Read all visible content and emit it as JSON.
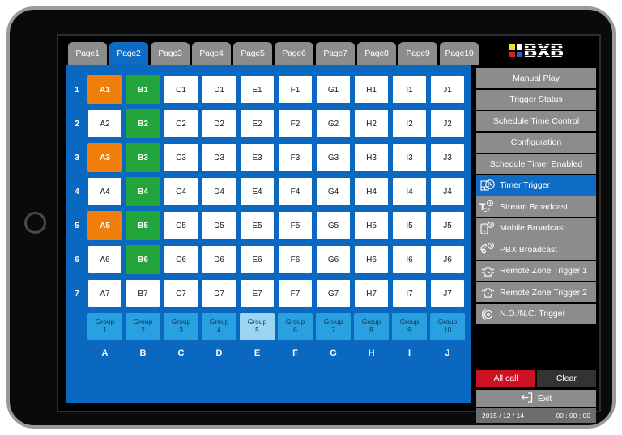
{
  "tabs": [
    {
      "label": "Page1",
      "active": false
    },
    {
      "label": "Page2",
      "active": true
    },
    {
      "label": "Page3",
      "active": false
    },
    {
      "label": "Page4",
      "active": false
    },
    {
      "label": "Page5",
      "active": false
    },
    {
      "label": "Page6",
      "active": false
    },
    {
      "label": "Page7",
      "active": false
    },
    {
      "label": "Page8",
      "active": false
    },
    {
      "label": "Page9",
      "active": false
    },
    {
      "label": "Page10",
      "active": false
    }
  ],
  "grid": {
    "row_numbers": [
      "1",
      "2",
      "3",
      "4",
      "5",
      "6",
      "7"
    ],
    "column_letters": [
      "A",
      "B",
      "C",
      "D",
      "E",
      "F",
      "G",
      "H",
      "I",
      "J"
    ],
    "rows": [
      [
        {
          "label": "A1",
          "state": "orange"
        },
        {
          "label": "B1",
          "state": "green"
        },
        {
          "label": "C1",
          "state": "off"
        },
        {
          "label": "D1",
          "state": "off"
        },
        {
          "label": "E1",
          "state": "off"
        },
        {
          "label": "F1",
          "state": "off"
        },
        {
          "label": "G1",
          "state": "off"
        },
        {
          "label": "H1",
          "state": "off"
        },
        {
          "label": "I1",
          "state": "off"
        },
        {
          "label": "J1",
          "state": "off"
        }
      ],
      [
        {
          "label": "A2",
          "state": "off"
        },
        {
          "label": "B2",
          "state": "green"
        },
        {
          "label": "C2",
          "state": "off"
        },
        {
          "label": "D2",
          "state": "off"
        },
        {
          "label": "E2",
          "state": "off"
        },
        {
          "label": "F2",
          "state": "off"
        },
        {
          "label": "G2",
          "state": "off"
        },
        {
          "label": "H2",
          "state": "off"
        },
        {
          "label": "I2",
          "state": "off"
        },
        {
          "label": "J2",
          "state": "off"
        }
      ],
      [
        {
          "label": "A3",
          "state": "orange"
        },
        {
          "label": "B3",
          "state": "green"
        },
        {
          "label": "C3",
          "state": "off"
        },
        {
          "label": "D3",
          "state": "off"
        },
        {
          "label": "E3",
          "state": "off"
        },
        {
          "label": "F3",
          "state": "off"
        },
        {
          "label": "G3",
          "state": "off"
        },
        {
          "label": "H3",
          "state": "off"
        },
        {
          "label": "I3",
          "state": "off"
        },
        {
          "label": "J3",
          "state": "off"
        }
      ],
      [
        {
          "label": "A4",
          "state": "off"
        },
        {
          "label": "B4",
          "state": "green"
        },
        {
          "label": "C4",
          "state": "off"
        },
        {
          "label": "D4",
          "state": "off"
        },
        {
          "label": "E4",
          "state": "off"
        },
        {
          "label": "F4",
          "state": "off"
        },
        {
          "label": "G4",
          "state": "off"
        },
        {
          "label": "H4",
          "state": "off"
        },
        {
          "label": "I4",
          "state": "off"
        },
        {
          "label": "J4",
          "state": "off"
        }
      ],
      [
        {
          "label": "A5",
          "state": "orange"
        },
        {
          "label": "B5",
          "state": "green"
        },
        {
          "label": "C5",
          "state": "off"
        },
        {
          "label": "D5",
          "state": "off"
        },
        {
          "label": "E5",
          "state": "off"
        },
        {
          "label": "F5",
          "state": "off"
        },
        {
          "label": "G5",
          "state": "off"
        },
        {
          "label": "H5",
          "state": "off"
        },
        {
          "label": "I5",
          "state": "off"
        },
        {
          "label": "J5",
          "state": "off"
        }
      ],
      [
        {
          "label": "A6",
          "state": "off"
        },
        {
          "label": "B6",
          "state": "green"
        },
        {
          "label": "C6",
          "state": "off"
        },
        {
          "label": "D6",
          "state": "off"
        },
        {
          "label": "E6",
          "state": "off"
        },
        {
          "label": "F6",
          "state": "off"
        },
        {
          "label": "G6",
          "state": "off"
        },
        {
          "label": "H6",
          "state": "off"
        },
        {
          "label": "I6",
          "state": "off"
        },
        {
          "label": "J6",
          "state": "off"
        }
      ],
      [
        {
          "label": "A7",
          "state": "off"
        },
        {
          "label": "B7",
          "state": "off"
        },
        {
          "label": "C7",
          "state": "off"
        },
        {
          "label": "D7",
          "state": "off"
        },
        {
          "label": "E7",
          "state": "off"
        },
        {
          "label": "F7",
          "state": "off"
        },
        {
          "label": "G7",
          "state": "off"
        },
        {
          "label": "H7",
          "state": "off"
        },
        {
          "label": "I7",
          "state": "off"
        },
        {
          "label": "J7",
          "state": "off"
        }
      ]
    ],
    "groups": [
      {
        "line1": "Group",
        "line2": "1",
        "selected": false
      },
      {
        "line1": "Group",
        "line2": "2",
        "selected": false
      },
      {
        "line1": "Group",
        "line2": "3",
        "selected": false
      },
      {
        "line1": "Group",
        "line2": "4",
        "selected": false
      },
      {
        "line1": "Group",
        "line2": "5",
        "selected": true
      },
      {
        "line1": "Group",
        "line2": "6",
        "selected": false
      },
      {
        "line1": "Group",
        "line2": "7",
        "selected": false
      },
      {
        "line1": "Group",
        "line2": "8",
        "selected": false
      },
      {
        "line1": "Group",
        "line2": "9",
        "selected": false
      },
      {
        "line1": "Group",
        "line2": "10",
        "selected": false
      }
    ]
  },
  "logo": {
    "text": "BXB",
    "square_colors": [
      "#f2e21a",
      "#ffffff",
      "#d81f26",
      "#2e5fc4"
    ]
  },
  "menu": [
    {
      "label": "Manual Play",
      "icon": null,
      "active": false
    },
    {
      "label": "Trigger Status",
      "icon": null,
      "active": false
    },
    {
      "label": "Schedule Time Control",
      "icon": null,
      "active": false
    },
    {
      "label": "Configuration",
      "icon": null,
      "active": false
    },
    {
      "label": "Schedule Timer Enabled",
      "icon": null,
      "active": false
    },
    {
      "label": "Timer Trigger",
      "icon": "timer-icon",
      "active": true
    },
    {
      "label": "Stream Broadcast",
      "icon": "tcp-stream-icon",
      "active": false
    },
    {
      "label": "Mobile Broadcast",
      "icon": "mobile-phone-icon",
      "active": false
    },
    {
      "label": "PBX Broadcast",
      "icon": "telephone-icon",
      "active": false
    },
    {
      "label": "Remote Zone Trigger 1",
      "icon": "alarm-clock-icon",
      "active": false
    },
    {
      "label": "Remote Zone Trigger 2",
      "icon": "alarm-clock-icon",
      "active": false
    },
    {
      "label": "N.O./N.C. Trigger",
      "icon": "sensor-icon",
      "active": false
    }
  ],
  "actions": {
    "all_call": "All call",
    "clear": "Clear",
    "exit": "Exit"
  },
  "status": {
    "date": "2015 / 12 / 14",
    "time": "00 : 00 : 00"
  },
  "colors": {
    "grid_blue": "#0b68c0",
    "tab_active": "#0f6cc4",
    "tab_inactive": "#8c8c8c",
    "cell_orange": "#ef7e0b",
    "cell_green": "#22a53a",
    "group_blue": "#29a0e0",
    "group_selected": "#9cd5f2",
    "all_call_red": "#cc1122"
  }
}
